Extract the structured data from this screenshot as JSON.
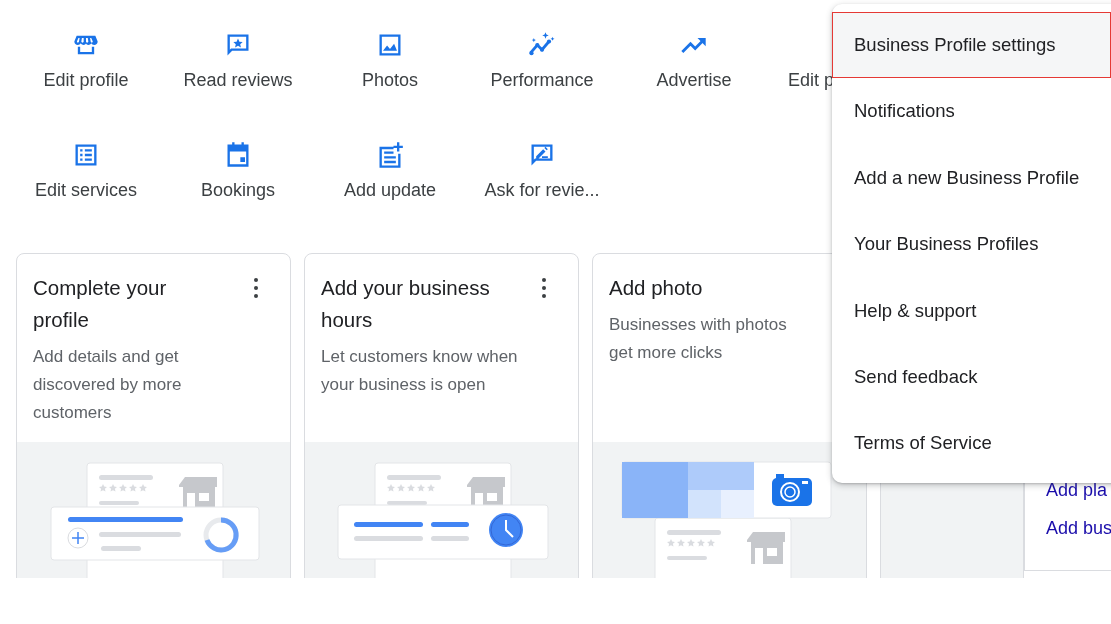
{
  "quick_actions": [
    {
      "label": "Edit profile"
    },
    {
      "label": "Read reviews"
    },
    {
      "label": "Photos"
    },
    {
      "label": "Performance"
    },
    {
      "label": "Advertise"
    },
    {
      "label": "Edit p"
    },
    {
      "label": "Edit services"
    },
    {
      "label": "Bookings"
    },
    {
      "label": "Add update"
    },
    {
      "label": "Ask for revie..."
    }
  ],
  "cards": [
    {
      "kind": "task",
      "title": "Complete your profile",
      "description": "Add details and get discovered by more customers",
      "more_button": true
    },
    {
      "kind": "task",
      "title": "Add your business hours",
      "description": "Let customers know when your business is open",
      "more_button": true
    },
    {
      "kind": "task",
      "title": "Add photo",
      "description": "Businesses with photos get more clicks",
      "more_button": false
    },
    {
      "kind": "covered"
    }
  ],
  "side_panel": {
    "links": [
      "Add pla",
      "Add bus"
    ]
  },
  "menu": {
    "items": [
      {
        "label": "Business Profile settings",
        "selected": true
      },
      {
        "label": "Notifications",
        "selected": false
      },
      {
        "label": "Add a new Business Profile",
        "selected": false
      },
      {
        "label": "Your Business Profiles",
        "selected": false
      },
      {
        "label": "Help & support",
        "selected": false
      },
      {
        "label": "Send feedback",
        "selected": false
      },
      {
        "label": "Terms of Service",
        "selected": false
      }
    ]
  }
}
